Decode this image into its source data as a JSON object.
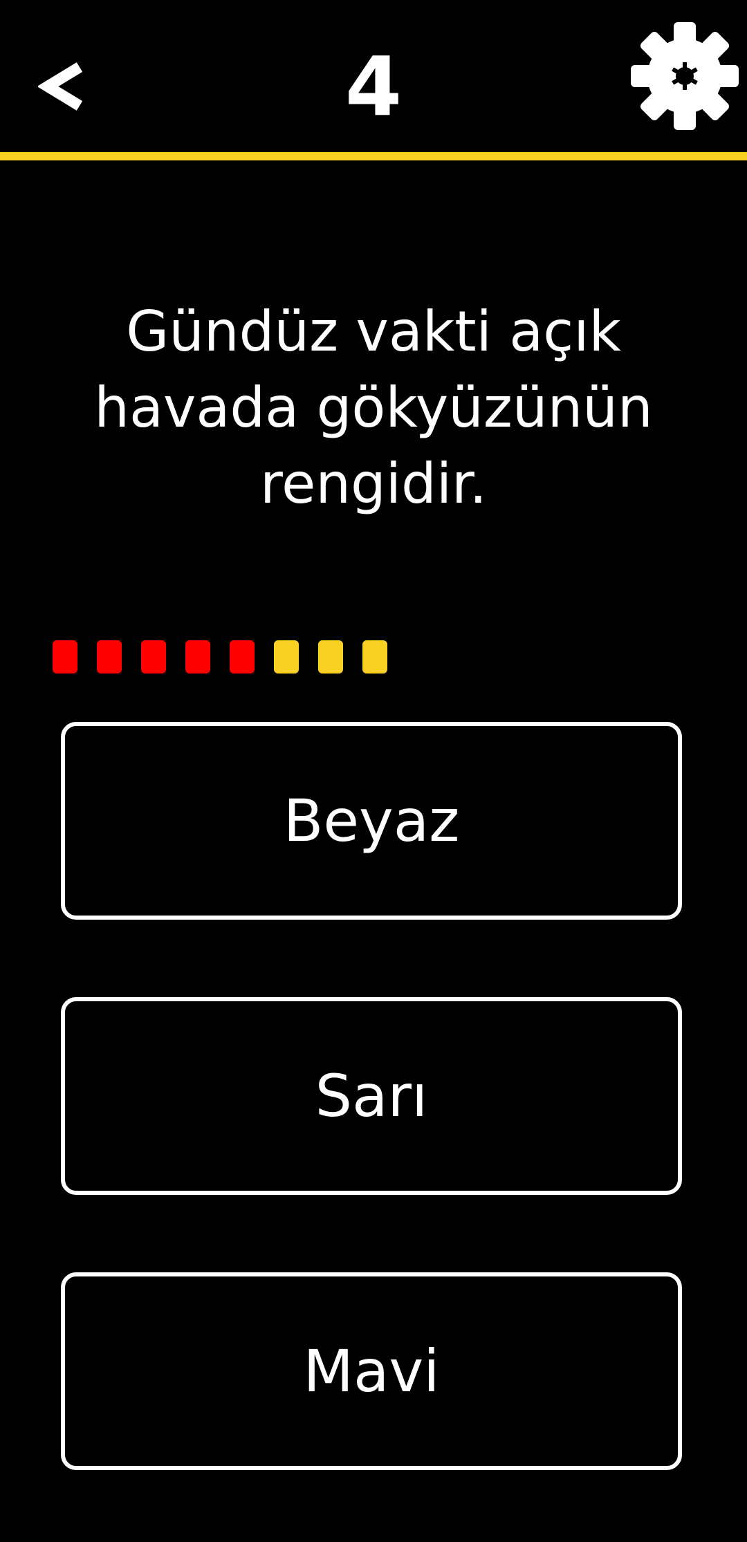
{
  "header": {
    "back_label": "<",
    "level": "4",
    "settings_icon": "gear-icon",
    "accent_color": "#f9d123"
  },
  "question": {
    "text": "Gündüz vakti açık\nhavada gökyüzünün\nrengidir."
  },
  "progress": {
    "total": 8,
    "used": 5,
    "colors": [
      "#ff0000",
      "#ff0000",
      "#ff0000",
      "#ff0000",
      "#ff0000",
      "#f9d123",
      "#f9d123",
      "#f9d123"
    ]
  },
  "answers": [
    {
      "label": "Beyaz"
    },
    {
      "label": "Sarı"
    },
    {
      "label": "Mavi"
    }
  ]
}
